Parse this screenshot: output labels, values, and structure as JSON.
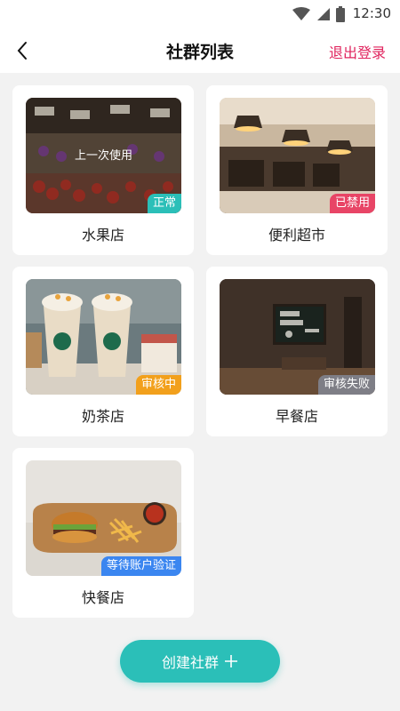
{
  "status_bar": {
    "time": "12:30"
  },
  "nav": {
    "title": "社群列表",
    "logout_label": "退出登录"
  },
  "communities": [
    {
      "name": "水果店",
      "status": "正常",
      "overlay": "上一次使用",
      "status_color": "#2bbfb8"
    },
    {
      "name": "便利超市",
      "status": "已禁用",
      "status_color": "#e84566"
    },
    {
      "name": "奶茶店",
      "status": "审核中",
      "status_color": "#f2a01c"
    },
    {
      "name": "早餐店",
      "status": "审核失败",
      "status_color": "#7e7e86"
    },
    {
      "name": "快餐店",
      "status": "等待账户验证",
      "status_color": "#3b86f0"
    }
  ],
  "create_button": {
    "label": "创建社群",
    "icon": "plus-icon"
  }
}
